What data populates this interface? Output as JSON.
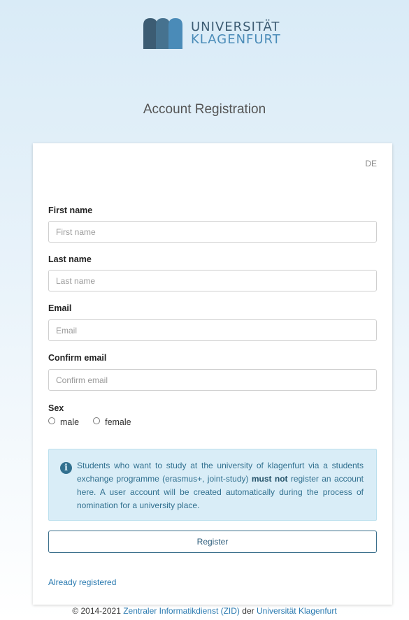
{
  "logo": {
    "line1": "UNIVERSITÄT",
    "line2": "KLAGENFURT",
    "colors": {
      "dark": "#3c5c73",
      "light": "#4a8bb8"
    }
  },
  "page_title": "Account Registration",
  "language_toggle": "DE",
  "form": {
    "first_name": {
      "label": "First name",
      "placeholder": "First name",
      "value": ""
    },
    "last_name": {
      "label": "Last name",
      "placeholder": "Last name",
      "value": ""
    },
    "email": {
      "label": "Email",
      "placeholder": "Email",
      "value": ""
    },
    "confirm_email": {
      "label": "Confirm email",
      "placeholder": "Confirm email",
      "value": ""
    },
    "sex": {
      "label": "Sex",
      "options": [
        "male",
        "female"
      ],
      "selected": null
    }
  },
  "info": {
    "icon": "info-circle-icon",
    "text_before": "Students who want to study at the university of klagenfurt via a students exchange programme (erasmus+, joint-study) ",
    "text_bold": "must not",
    "text_after": " register an account here. A user account will be created automatically during the process of nomination for a university place."
  },
  "register_label": "Register",
  "already_registered_label": "Already registered",
  "footer": {
    "prefix": "© 2014-2021 ",
    "link1": "Zentraler Informatikdienst (ZID)",
    "middle": " der ",
    "link2": "Universität Klagenfurt"
  }
}
